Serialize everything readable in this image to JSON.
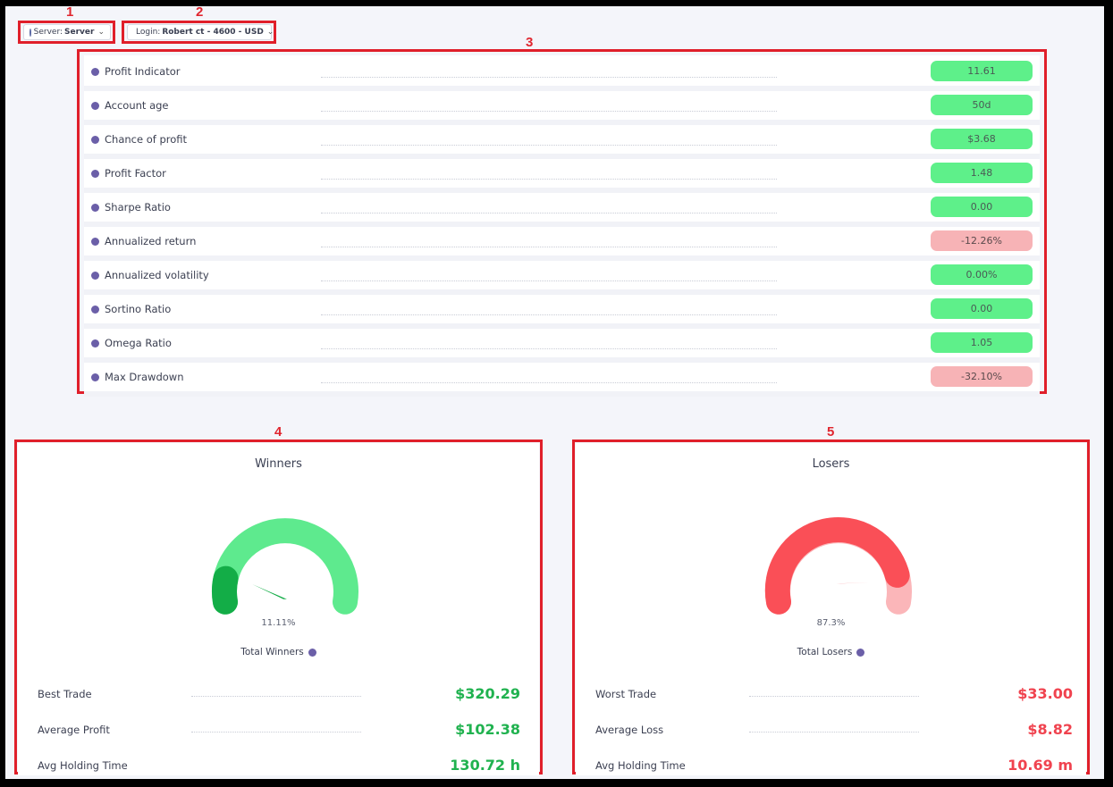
{
  "annotations": [
    "1",
    "2",
    "3",
    "4",
    "5"
  ],
  "server_selector": {
    "prefix": "Server:",
    "value": "Server",
    "icon": "user-icon"
  },
  "login_selector": {
    "prefix": "Login:",
    "value": "Robert ct - 4600 - USD",
    "icon": "account-icon"
  },
  "metrics": [
    {
      "label": "Profit Indicator",
      "value": "11.61",
      "status": "good"
    },
    {
      "label": "Account age",
      "value": "50d",
      "status": "good"
    },
    {
      "label": "Chance of profit",
      "value": "$3.68",
      "status": "good"
    },
    {
      "label": "Profit Factor",
      "value": "1.48",
      "status": "good"
    },
    {
      "label": "Sharpe Ratio",
      "value": "0.00",
      "status": "good"
    },
    {
      "label": "Annualized return",
      "value": "-12.26%",
      "status": "bad"
    },
    {
      "label": "Annualized volatility",
      "value": "0.00%",
      "status": "good"
    },
    {
      "label": "Sortino Ratio",
      "value": "0.00",
      "status": "good"
    },
    {
      "label": "Omega Ratio",
      "value": "1.05",
      "status": "good"
    },
    {
      "label": "Max Drawdown",
      "value": "-32.10%",
      "status": "bad"
    }
  ],
  "winners": {
    "title": "Winners",
    "percent_label": "11.11%",
    "fraction": 0.1111,
    "total_label": "Total Winners",
    "stats": [
      {
        "label": "Best Trade",
        "value": "$320.29"
      },
      {
        "label": "Average Profit",
        "value": "$102.38"
      },
      {
        "label": "Avg Holding Time",
        "value": "130.72 h"
      }
    ]
  },
  "losers": {
    "title": "Losers",
    "percent_label": "87.3%",
    "fraction": 0.873,
    "total_label": "Total Losers",
    "stats": [
      {
        "label": "Worst Trade",
        "value": "$33.00"
      },
      {
        "label": "Average Loss",
        "value": "$8.82"
      },
      {
        "label": "Avg Holding Time",
        "value": "10.69 m"
      }
    ]
  },
  "colors": {
    "good": "#5ef08a",
    "bad": "#f7b3b6",
    "annotation": "#e01f2a",
    "winner_light": "#5eea8e",
    "winner_dark": "#13ad47",
    "loser_main": "#fa4f57",
    "loser_light": "#fbb6b9"
  }
}
